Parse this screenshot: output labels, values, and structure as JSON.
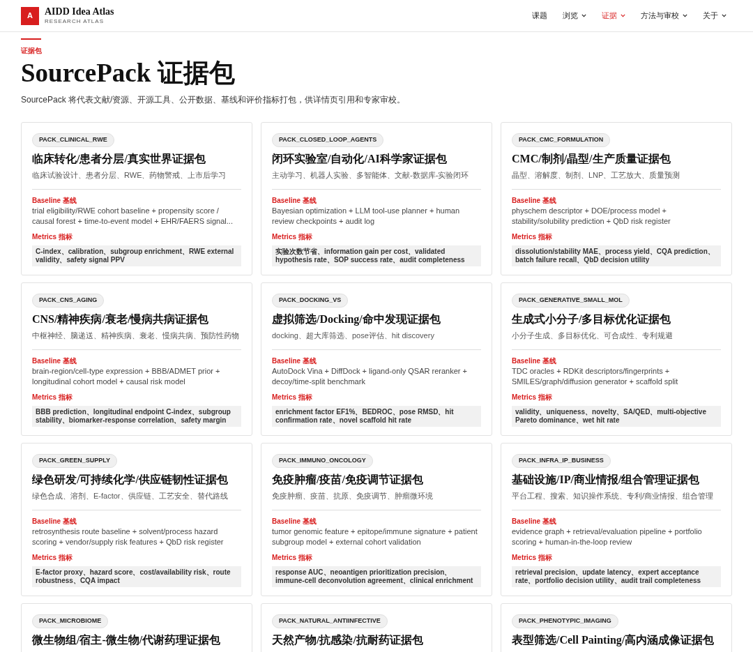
{
  "brand": {
    "logo": "A",
    "name": "AIDD Idea Atlas",
    "tagline": "RESEARCH ATLAS"
  },
  "nav": [
    {
      "label": "课题",
      "selected": false,
      "dropdown": false
    },
    {
      "label": "浏览",
      "selected": false,
      "dropdown": true
    },
    {
      "label": "证据",
      "selected": true,
      "dropdown": true
    },
    {
      "label": "方法与审校",
      "selected": false,
      "dropdown": true
    },
    {
      "label": "关于",
      "selected": false,
      "dropdown": true
    }
  ],
  "page": {
    "eyebrow": "证据包",
    "title": "SourcePack 证据包",
    "description": "SourcePack 将代表文献/资源、开源工具、公开数据、基线和评价指标打包，供详情页引用和专家审校。"
  },
  "packs": [
    {
      "id": "PACK_CLINICAL_RWE",
      "title": "临床转化/患者分层/真实世界证据包",
      "topics": "临床试验设计、患者分层、RWE、药物警戒、上市后学习",
      "baseline_label": "Baseline 基线",
      "baseline": "trial eligibility/RWE cohort baseline + propensity score / causal forest + time-to-event model + EHR/FAERS signal...",
      "metrics_label": "Metrics 指标",
      "metrics": "C-index、calibration、subgroup enrichment、RWE external validity、safety signal PPV"
    },
    {
      "id": "PACK_CLOSED_LOOP_AGENTS",
      "title": "闭环实验室/自动化/AI科学家证据包",
      "topics": "主动学习、机器人实验、多智能体、文献-数据库-实验闭环",
      "baseline_label": "Baseline 基线",
      "baseline": "Bayesian optimization + LLM tool-use planner + human review checkpoints + audit log",
      "metrics_label": "Metrics 指标",
      "metrics": "实验次数节省、information gain per cost、validated hypothesis rate、SOP success rate、audit completeness"
    },
    {
      "id": "PACK_CMC_FORMULATION",
      "title": "CMC/制剂/晶型/生产质量证据包",
      "topics": "晶型、溶解度、制剂、LNP、工艺放大、质量预测",
      "baseline_label": "Baseline 基线",
      "baseline": "physchem descriptor + DOE/process model + stability/solubility prediction + QbD risk register",
      "metrics_label": "Metrics 指标",
      "metrics": "dissolution/stability MAE、process yield、CQA prediction、batch failure recall、QbD decision utility"
    },
    {
      "id": "PACK_CNS_AGING",
      "title": "CNS/精神疾病/衰老/慢病共病证据包",
      "topics": "中枢神经、脑递送、精神疾病、衰老、慢病共病、预防性药物",
      "baseline_label": "Baseline 基线",
      "baseline": "brain-region/cell-type expression + BBB/ADMET prior + longitudinal cohort model + causal risk model",
      "metrics_label": "Metrics 指标",
      "metrics": "BBB prediction、longitudinal endpoint C-index、subgroup stability、biomarker-response correlation、safety margin"
    },
    {
      "id": "PACK_DOCKING_VS",
      "title": "虚拟筛选/Docking/命中发现证据包",
      "topics": "docking、超大库筛选、pose评估、hit discovery",
      "baseline_label": "Baseline 基线",
      "baseline": "AutoDock Vina + DiffDock + ligand-only QSAR reranker + decoy/time-split benchmark",
      "metrics_label": "Metrics 指标",
      "metrics": "enrichment factor EF1%、BEDROC、pose RMSD、hit confirmation rate、novel scaffold hit rate"
    },
    {
      "id": "PACK_GENERATIVE_SMALL_MOL",
      "title": "生成式小分子/多目标优化证据包",
      "topics": "小分子生成、多目标优化、可合成性、专利规避",
      "baseline_label": "Baseline 基线",
      "baseline": "TDC oracles + RDKit descriptors/fingerprints + SMILES/graph/diffusion generator + scaffold split",
      "metrics_label": "Metrics 指标",
      "metrics": "validity、uniqueness、novelty、SA/QED、multi-objective Pareto dominance、wet hit rate"
    },
    {
      "id": "PACK_GREEN_SUPPLY",
      "title": "绿色研发/可持续化学/供应链韧性证据包",
      "topics": "绿色合成、溶剂、E-factor、供应链、工艺安全、替代路线",
      "baseline_label": "Baseline 基线",
      "baseline": "retrosynthesis route baseline + solvent/process hazard scoring + vendor/supply risk features + QbD risk register",
      "metrics_label": "Metrics 指标",
      "metrics": "E-factor proxy、hazard score、cost/availability risk、route robustness、CQA impact"
    },
    {
      "id": "PACK_IMMUNO_ONCOLOGY",
      "title": "免疫肿瘤/疫苗/免疫调节证据包",
      "topics": "免疫肿瘤、疫苗、抗原、免疫调节、肿瘤微环境",
      "baseline_label": "Baseline 基线",
      "baseline": "tumor genomic feature + epitope/immune signature + patient subgroup model + external cohort validation",
      "metrics_label": "Metrics 指标",
      "metrics": "response AUC、neoantigen prioritization precision、immune-cell deconvolution agreement、clinical enrichment"
    },
    {
      "id": "PACK_INFRA_IP_BUSINESS",
      "title": "基础设施/IP/商业情报/组合管理证据包",
      "topics": "平台工程、搜索、知识操作系统、专利/商业情报、组合管理",
      "baseline_label": "Baseline 基线",
      "baseline": "evidence graph + retrieval/evaluation pipeline + portfolio scoring + human-in-the-loop review",
      "metrics_label": "Metrics 指标",
      "metrics": "retrieval precision、update latency、expert acceptance rate、portfolio decision utility、audit trail completeness"
    },
    {
      "id": "PACK_MICROBIOME",
      "title": "微生物组/宿主-微生物/代谢药理证据包"
    },
    {
      "id": "PACK_NATURAL_ANTIINFECTIVE",
      "title": "天然产物/抗感染/抗耐药证据包"
    },
    {
      "id": "PACK_PHENOTYPIC_IMAGING",
      "title": "表型筛选/Cell Painting/高内涵成像证据包"
    }
  ]
}
